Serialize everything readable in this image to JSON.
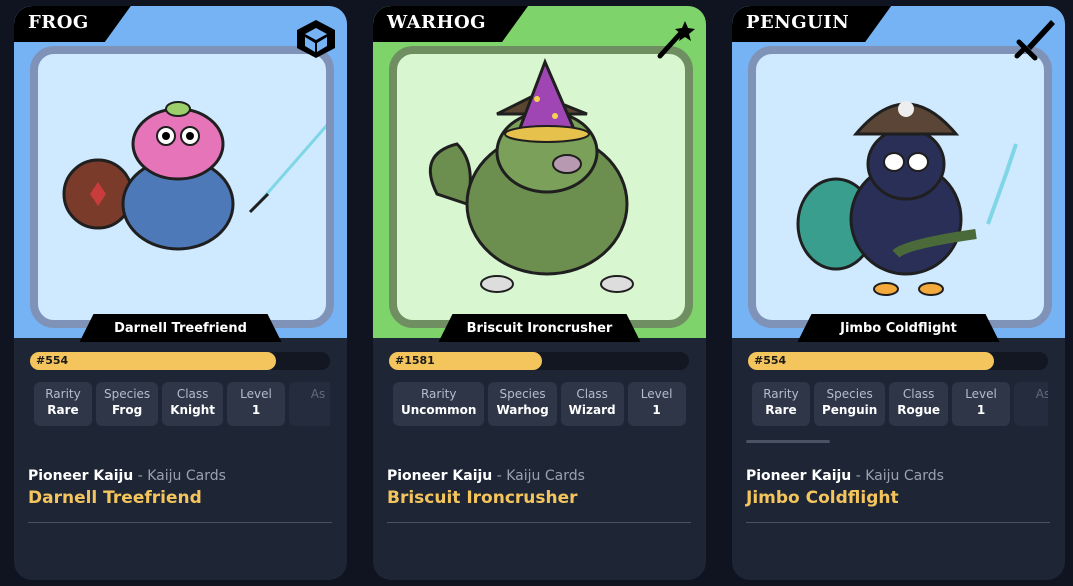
{
  "cards": [
    {
      "species_tab": "FROG",
      "class_icon": "shield-icon",
      "frame_color": "#76b3f5",
      "art_bg": "#cfe9ff",
      "art_border": "#7f93b8",
      "name_plate": "Darnell Treefriend",
      "xp_label": "#554",
      "xp_progress": 0.82,
      "attributes": [
        {
          "label": "Rarity",
          "value": "Rare"
        },
        {
          "label": "Species",
          "value": "Frog"
        },
        {
          "label": "Class",
          "value": "Knight"
        },
        {
          "label": "Level",
          "value": "1"
        },
        {
          "label": "As",
          "value": ""
        }
      ],
      "collection": "Pioneer Kaiju",
      "collection_sub": "Kaiju Cards",
      "title": "Darnell Treefriend"
    },
    {
      "species_tab": "WARHOG",
      "class_icon": "magic-wand-icon",
      "frame_color": "#7ed36a",
      "art_bg": "#d8f6d0",
      "art_border": "#6f8f63",
      "name_plate": "Briscuit Ironcrusher",
      "xp_label": "#1581",
      "xp_progress": 0.51,
      "attributes": [
        {
          "label": "Rarity",
          "value": "Uncommon"
        },
        {
          "label": "Species",
          "value": "Warhog"
        },
        {
          "label": "Class",
          "value": "Wizard"
        },
        {
          "label": "Level",
          "value": "1"
        }
      ],
      "collection": "Pioneer Kaiju",
      "collection_sub": "Kaiju Cards",
      "title": "Briscuit Ironcrusher"
    },
    {
      "species_tab": "PENGUIN",
      "class_icon": "sword-icon",
      "frame_color": "#76b3f5",
      "art_bg": "#cfe9ff",
      "art_border": "#7f93b8",
      "name_plate": "Jimbo Coldflight",
      "xp_label": "#554",
      "xp_progress": 0.82,
      "attributes": [
        {
          "label": "Rarity",
          "value": "Rare"
        },
        {
          "label": "Species",
          "value": "Penguin"
        },
        {
          "label": "Class",
          "value": "Rogue"
        },
        {
          "label": "Level",
          "value": "1"
        },
        {
          "label": "As",
          "value": ""
        }
      ],
      "collection": "Pioneer Kaiju",
      "collection_sub": "Kaiju Cards",
      "title": "Jimbo Coldflight"
    }
  ]
}
